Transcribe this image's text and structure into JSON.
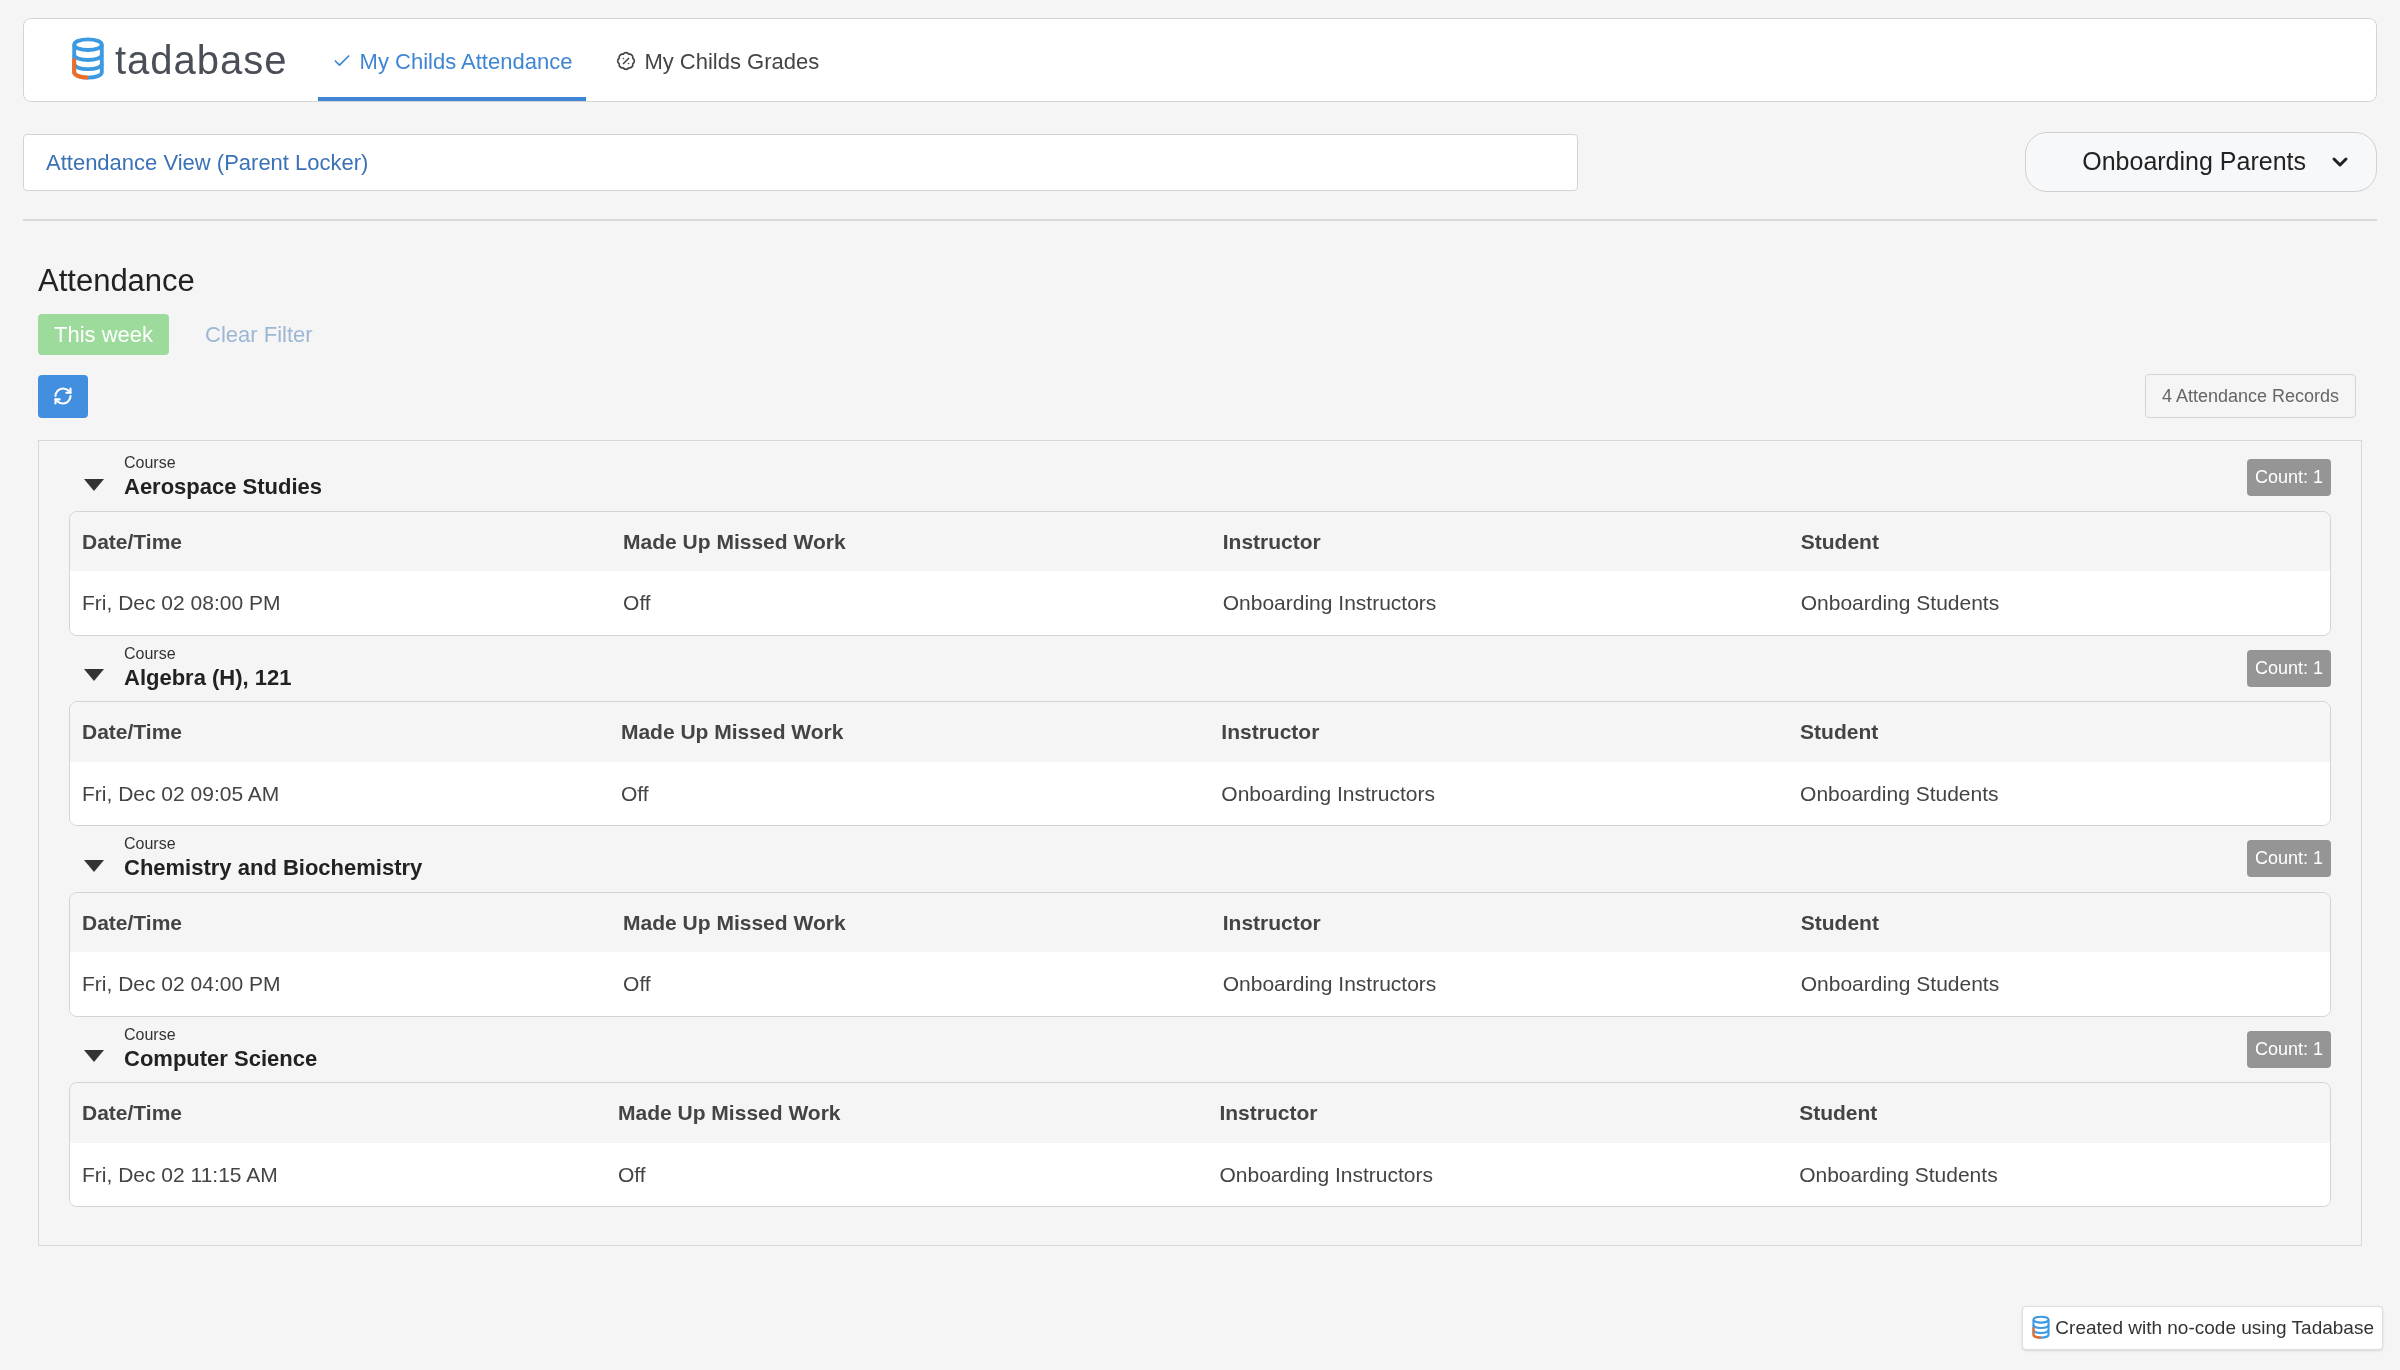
{
  "nav": {
    "logo_text": "tadabase",
    "tabs": [
      {
        "label": "My Childs Attendance",
        "kind": "check",
        "selected": true
      },
      {
        "label": "My Childs Grades",
        "kind": "percent",
        "selected": false
      }
    ]
  },
  "breadcrumb": "Attendance View (Parent Locker)",
  "user_menu": "Onboarding Parents",
  "section_title": "Attendance",
  "filters": [
    {
      "label": "This week",
      "selected": true
    },
    {
      "label": "Clear Filter",
      "selected": false
    }
  ],
  "records_count": "4 Attendance Records",
  "groups": [
    {
      "label": "Course",
      "name": "Aerospace Studies",
      "expanded": true,
      "count": "Count: 1",
      "columns": [
        "Date/Time",
        "Made Up Missed Work",
        "Instructor",
        "Student"
      ],
      "rows": [
        [
          "Fri, Dec 02 08:00 PM",
          "Off",
          "Onboarding Instructors",
          "Onboarding Students"
        ]
      ]
    },
    {
      "label": "Course",
      "name": "Algebra (H), 121",
      "expanded": true,
      "count": "Count: 1",
      "columns": [
        "Date/Time",
        "Made Up Missed Work",
        "Instructor",
        "Student"
      ],
      "rows": [
        [
          "Fri, Dec 02 09:05 AM",
          "Off",
          "Onboarding Instructors",
          "Onboarding Students"
        ]
      ]
    },
    {
      "label": "Course",
      "name": "Chemistry and Biochemistry",
      "expanded": true,
      "count": "Count: 1",
      "columns": [
        "Date/Time",
        "Made Up Missed Work",
        "Instructor",
        "Student"
      ],
      "rows": [
        [
          "Fri, Dec 02 04:00 PM",
          "Off",
          "Onboarding Instructors",
          "Onboarding Students"
        ]
      ]
    },
    {
      "label": "Course",
      "name": "Computer Science",
      "expanded": true,
      "count": "Count: 1",
      "columns": [
        "Date/Time",
        "Made Up Missed Work",
        "Instructor",
        "Student"
      ],
      "rows": [
        [
          "Fri, Dec 02 11:15 AM",
          "Off",
          "Onboarding Instructors",
          "Onboarding Students"
        ]
      ]
    }
  ],
  "footer_badge": "Created with no-code using Tadabase"
}
